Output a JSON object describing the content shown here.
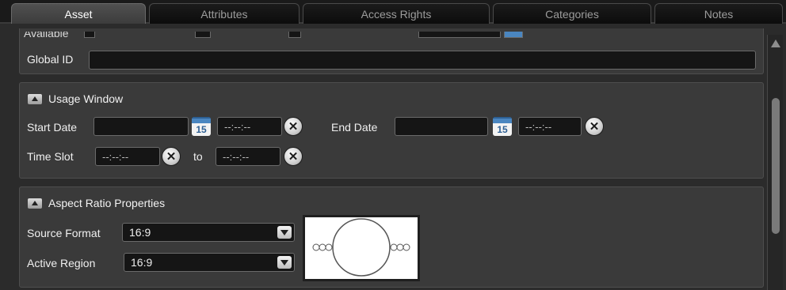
{
  "tabs": [
    {
      "label": "Asset",
      "active": true
    },
    {
      "label": "Attributes",
      "active": false
    },
    {
      "label": "Access Rights",
      "active": false
    },
    {
      "label": "Categories",
      "active": false
    },
    {
      "label": "Notes",
      "active": false
    }
  ],
  "global_id": {
    "label": "Global ID",
    "value": ""
  },
  "usage_window": {
    "title": "Usage Window",
    "start_date_label": "Start Date",
    "start_date_value": "",
    "start_time_placeholder": "--:--:--",
    "end_date_label": "End Date",
    "end_date_value": "",
    "end_time_placeholder": "--:--:--",
    "time_slot_label": "Time Slot",
    "time_slot_from_placeholder": "--:--:--",
    "to_label": "to",
    "time_slot_to_placeholder": "--:--:--",
    "calendar_day": "15"
  },
  "aspect_ratio": {
    "title": "Aspect Ratio Properties",
    "source_format_label": "Source Format",
    "source_format_value": "16:9",
    "active_region_label": "Active Region",
    "active_region_value": "16:9"
  },
  "icons": {
    "collapse": "collapse-arrow-icon",
    "calendar": "calendar-icon",
    "clear": "clear-x-icon",
    "dropdown": "chevron-down-icon",
    "scroll_up": "scroll-up-icon"
  },
  "colors": {
    "background": "#2b2b2b",
    "panel": "#3a3a3a",
    "field": "#151515",
    "calendar_blue": "#4a86c0",
    "active_tab": "#4a4a4a"
  }
}
